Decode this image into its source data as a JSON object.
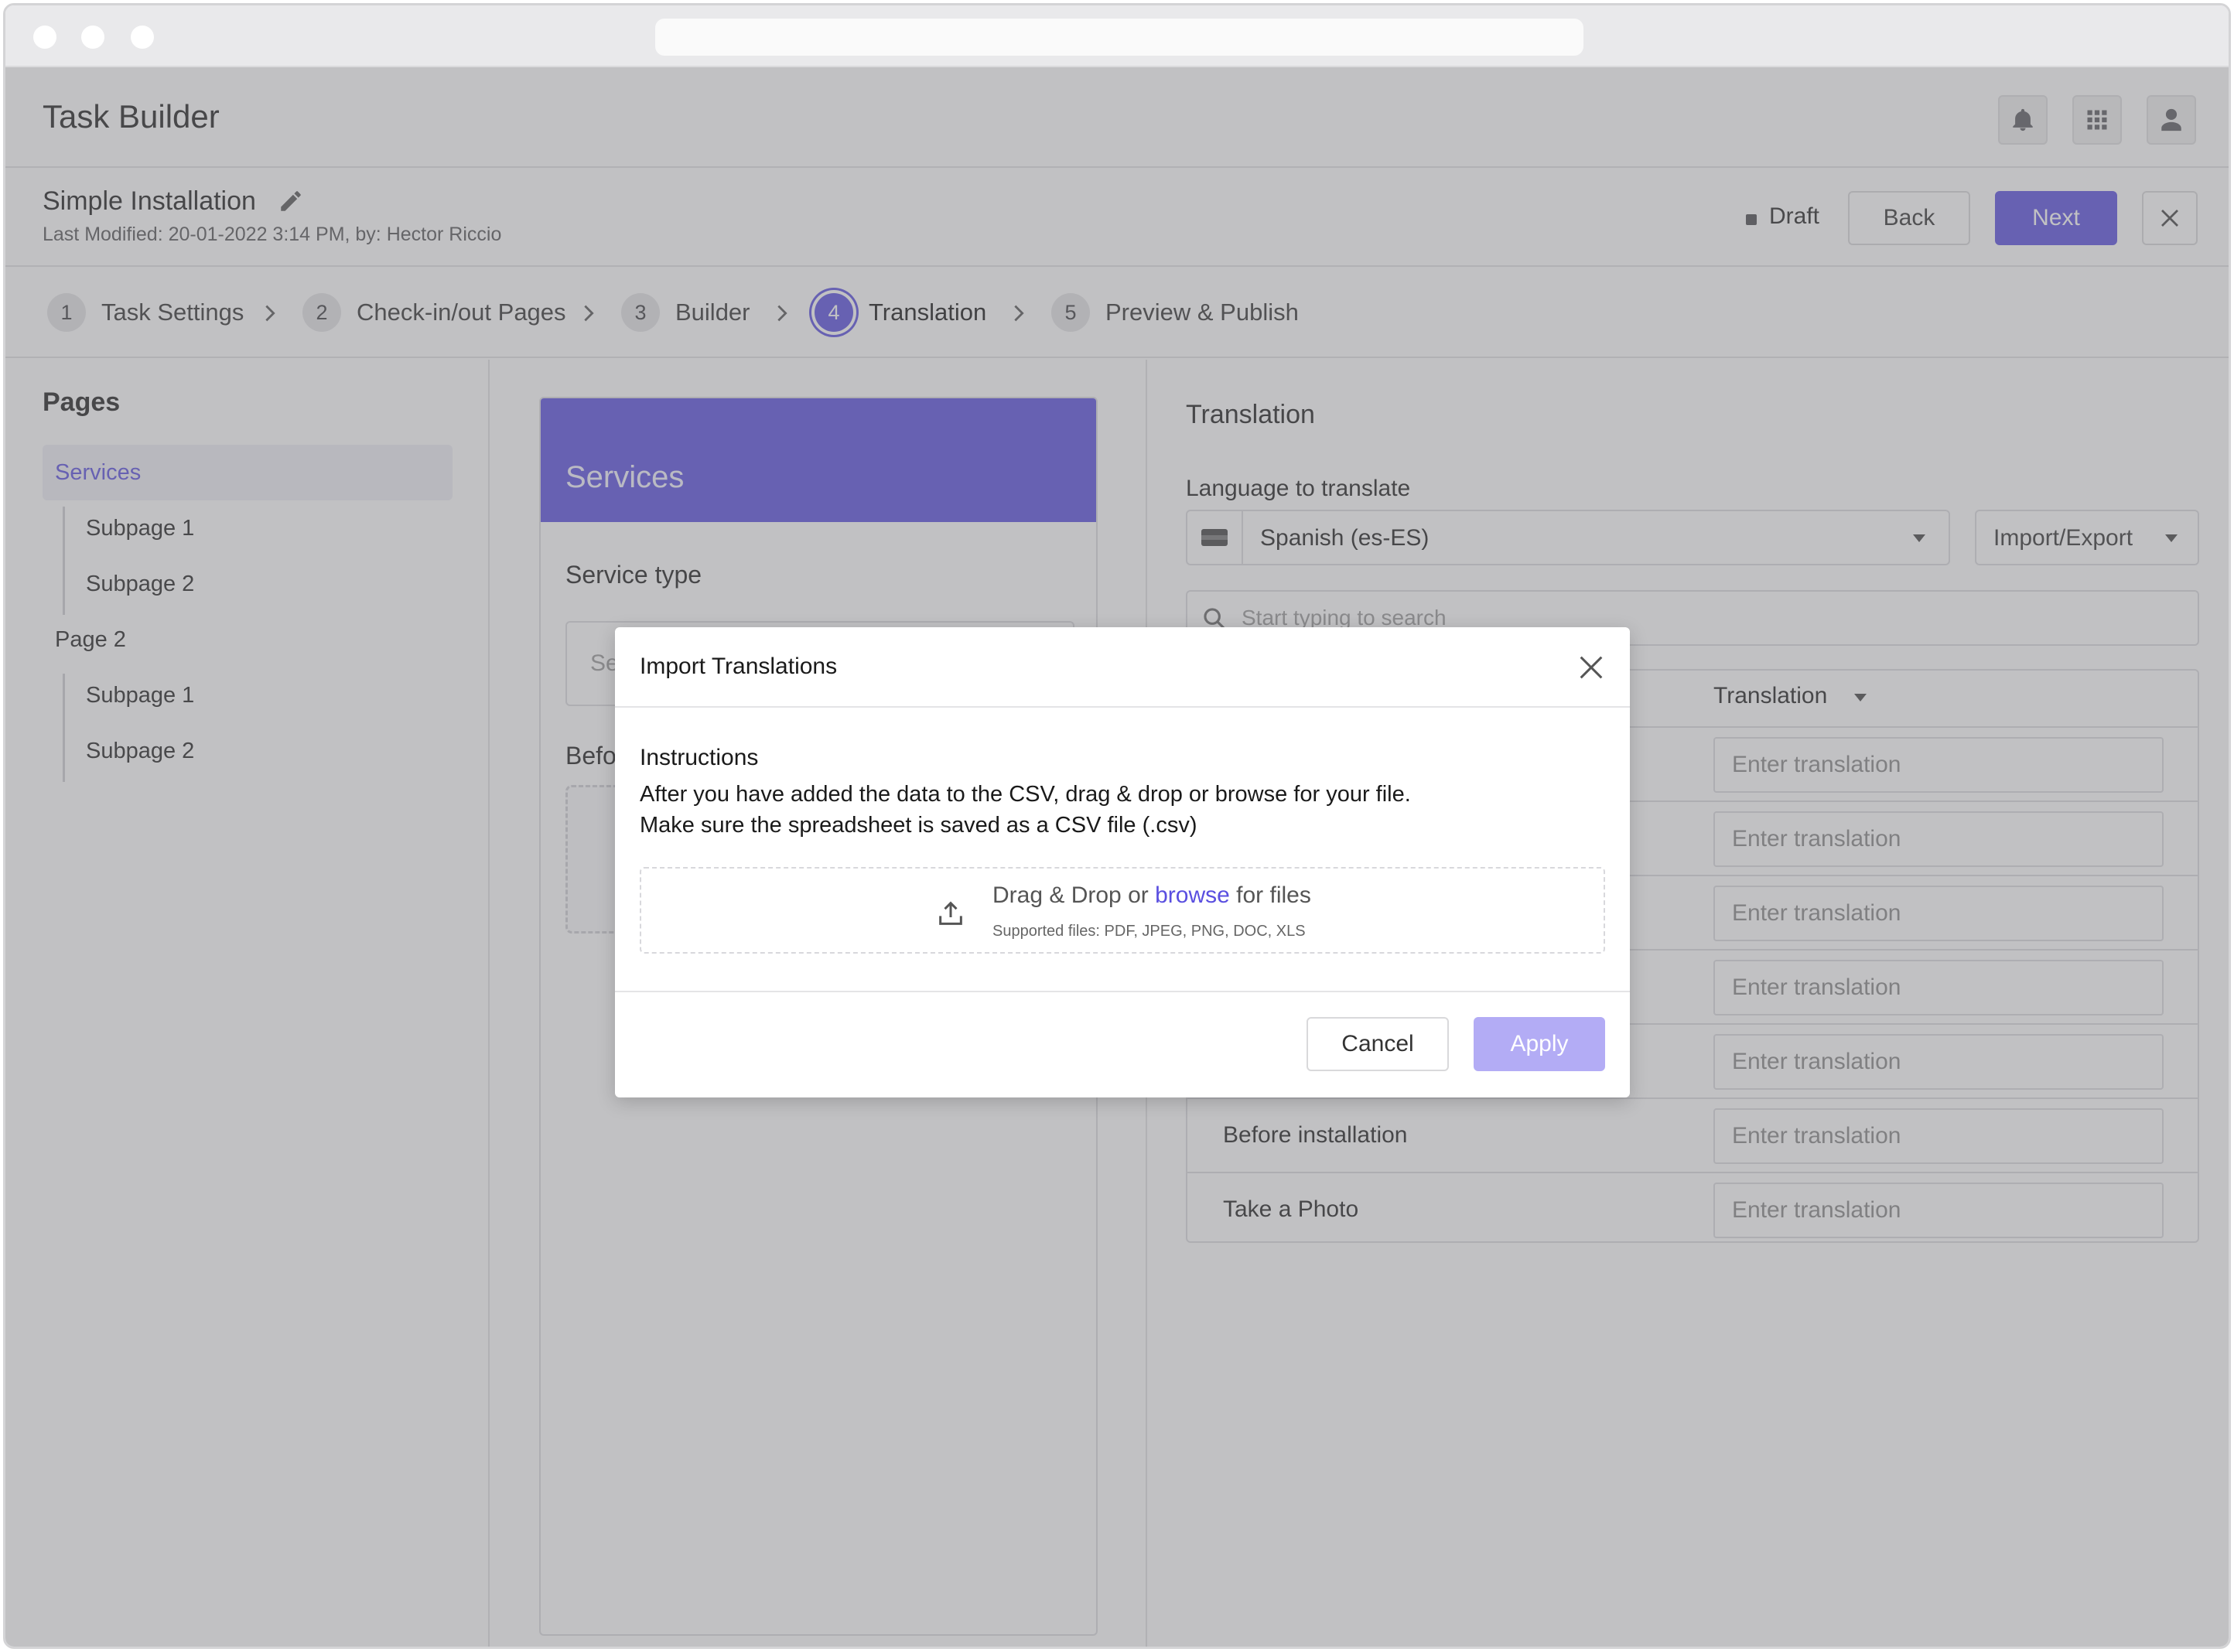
{
  "app": {
    "title": "Task Builder"
  },
  "task": {
    "name": "Simple Installation",
    "meta": "Last Modified: 20-01-2022 3:14 PM, by: Hector Riccio",
    "status": "Draft"
  },
  "header_buttons": {
    "back": "Back",
    "next": "Next"
  },
  "steps": [
    {
      "num": "1",
      "label": "Task Settings"
    },
    {
      "num": "2",
      "label": "Check-in/out Pages"
    },
    {
      "num": "3",
      "label": "Builder"
    },
    {
      "num": "4",
      "label": "Translation"
    },
    {
      "num": "5",
      "label": "Preview & Publish"
    }
  ],
  "pages": {
    "title": "Pages",
    "items": [
      {
        "label": "Services"
      },
      {
        "label": "Subpage 1"
      },
      {
        "label": "Subpage 2"
      },
      {
        "label": "Page 2"
      },
      {
        "label": "Subpage 1"
      },
      {
        "label": "Subpage 2"
      }
    ]
  },
  "preview": {
    "header": "Services",
    "field1_label": "Service type",
    "field1_placeholder": "Se",
    "field2_label": "Befo"
  },
  "translation": {
    "title": "Translation",
    "language_label": "Language to translate",
    "language_value": "Spanish (es-ES)",
    "import_export": "Import/Export",
    "search_placeholder": "Start typing to search",
    "column_header": "Translation",
    "input_placeholder": "Enter translation",
    "rows": [
      {
        "source": ""
      },
      {
        "source": ""
      },
      {
        "source": ""
      },
      {
        "source": ""
      },
      {
        "source": ""
      },
      {
        "source": "Before installation"
      },
      {
        "source": "Take a Photo"
      }
    ]
  },
  "modal": {
    "title": "Import Translations",
    "instructions_title": "Instructions",
    "line1": "After you have added the data to the CSV, drag & drop or browse for your file.",
    "line2": "Make sure the spreadsheet is saved as a CSV file (.csv)",
    "drop_prefix": "Drag & Drop or",
    "drop_link": "browse",
    "drop_suffix": "for files",
    "supported": "Supported files: PDF, JPEG, PNG, DOC, XLS",
    "cancel": "Cancel",
    "apply": "Apply"
  },
  "colors": {
    "accent": "#5a4fe0",
    "apply_disabled": "#b3acf5"
  }
}
